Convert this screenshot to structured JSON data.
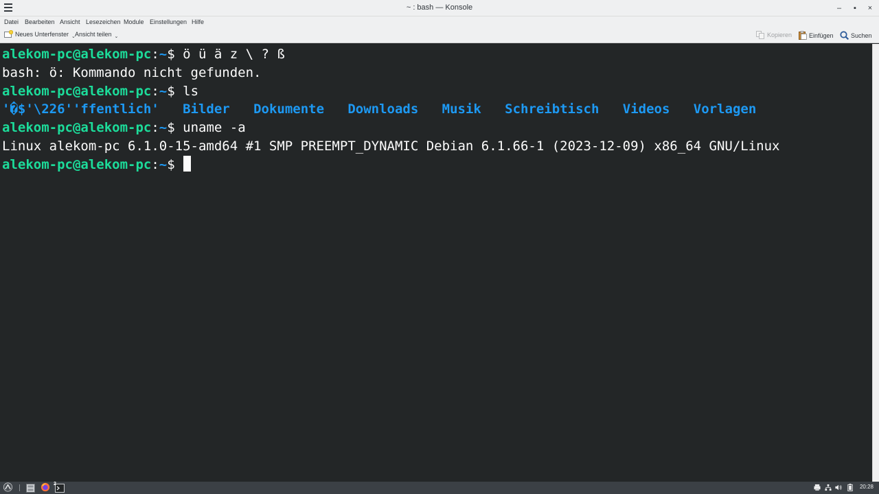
{
  "window": {
    "title": "~ : bash — Konsole",
    "minimize_glyph": "–",
    "maximize_glyph": "▪",
    "close_glyph": "×"
  },
  "menubar": {
    "items": [
      "Datei",
      "Bearbeiten",
      "Ansicht",
      "Lesezeichen",
      "Module",
      "Einstellungen",
      "Hilfe"
    ]
  },
  "toolbar": {
    "new_tab": "Neues Unterfenster",
    "split_view": "Ansicht teilen",
    "copy": "Kopieren",
    "paste": "Einfügen",
    "search": "Suchen",
    "dropdown_glyph": "⌄"
  },
  "terminal": {
    "prompt_user": "alekom-pc@alekom-pc",
    "prompt_sep": ":",
    "prompt_path": "~",
    "prompt_sign": "$ ",
    "lines": [
      {
        "type": "prompt",
        "command": "ö ü ä z \\ ? ß"
      },
      {
        "type": "output",
        "text": "bash: ö: Kommando nicht gefunden."
      },
      {
        "type": "prompt",
        "command": "ls"
      },
      {
        "type": "ls",
        "quoted": "'�$'\\226''ffentlich'",
        "dirs": [
          "Bilder",
          "Dokumente",
          "Downloads",
          "Musik",
          "Schreibtisch",
          "Videos",
          "Vorlagen"
        ]
      },
      {
        "type": "prompt",
        "command": "uname -a"
      },
      {
        "type": "output",
        "text": "Linux alekom-pc 6.1.0-15-amd64 #1 SMP PREEMPT_DYNAMIC Debian 6.1.66-1 (2023-12-09) x86_64 GNU/Linux"
      },
      {
        "type": "prompt",
        "command": "",
        "cursor": true
      }
    ]
  },
  "taskbar": {
    "clock": "20:28",
    "launcher_badge": "2"
  },
  "colors": {
    "terminal_bg": "#232627",
    "prompt_user": "#1cdc9a",
    "directory": "#1d99f3",
    "text": "#fcfcfc"
  }
}
